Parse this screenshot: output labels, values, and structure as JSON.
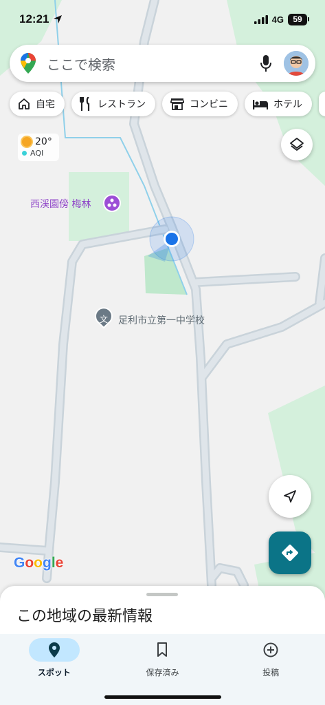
{
  "status": {
    "time": "12:21",
    "network": "4G",
    "battery": "59"
  },
  "search": {
    "placeholder": "ここで検索"
  },
  "chips": [
    {
      "label": "自宅",
      "icon": "home-icon"
    },
    {
      "label": "レストラン",
      "icon": "restaurant-icon"
    },
    {
      "label": "コンビニ",
      "icon": "store-icon"
    },
    {
      "label": "ホテル",
      "icon": "hotel-icon"
    }
  ],
  "weather": {
    "temp": "20°",
    "aqi": "AQI"
  },
  "map": {
    "poi_park": "西渓園傍 梅林",
    "poi_school": "足利市立第一中学校",
    "poi_park_color": "#8e44c8",
    "poi_school_color": "#5f6b73",
    "google_logo": [
      "G",
      "o",
      "o",
      "g",
      "l",
      "e"
    ],
    "google_colors": [
      "#4285f4",
      "#ea4335",
      "#fbbc05",
      "#4285f4",
      "#34a853",
      "#ea4335"
    ],
    "road_color": "#c9d3da",
    "park_color": "#d4f0dc",
    "location_color": "#1a73e8"
  },
  "sheet": {
    "title": "この地域の最新情報"
  },
  "nav": [
    {
      "label": "スポット",
      "icon": "explore-pin-icon",
      "active": true
    },
    {
      "label": "保存済み",
      "icon": "bookmark-icon",
      "active": false
    },
    {
      "label": "投稿",
      "icon": "add-circle-icon",
      "active": false
    }
  ],
  "colors": {
    "accent": "#0b7487",
    "nav_active": "#c2e7ff"
  }
}
